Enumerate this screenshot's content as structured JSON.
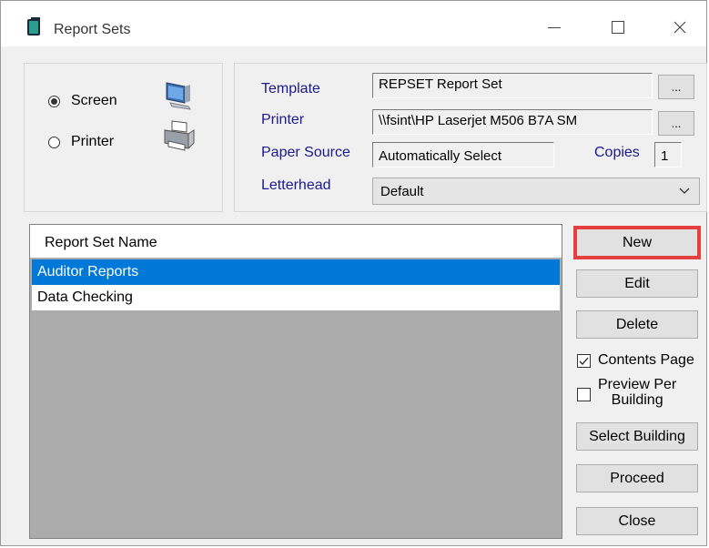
{
  "window": {
    "title": "Report Sets"
  },
  "output": {
    "screen_label": "Screen",
    "printer_label": "Printer",
    "selected": "Screen"
  },
  "settings": {
    "template_label": "Template",
    "template_value": "REPSET Report Set",
    "printer_label": "Printer",
    "printer_value": "\\\\fsint\\HP Laserjet M506 B7A SM",
    "paper_source_label": "Paper Source",
    "paper_source_value": "Automatically Select",
    "copies_label": "Copies",
    "copies_value": "1",
    "letterhead_label": "Letterhead",
    "letterhead_value": "Default",
    "browse_label": "..."
  },
  "list": {
    "header": "Report Set Name",
    "rows": [
      "Auditor Reports",
      "Data Checking"
    ],
    "selected_index": 0
  },
  "buttons": {
    "new": "New",
    "edit": "Edit",
    "delete": "Delete",
    "select_building": "Select Building",
    "proceed": "Proceed",
    "close": "Close"
  },
  "options": {
    "contents_page_label": "Contents Page",
    "contents_page_checked": true,
    "preview_per_building_label_1": "Preview Per",
    "preview_per_building_label_2": "Building",
    "preview_per_building_checked": false
  },
  "colors": {
    "selection": "#0078d7",
    "highlight": "#e53f3f",
    "label": "#1a1a8c"
  }
}
